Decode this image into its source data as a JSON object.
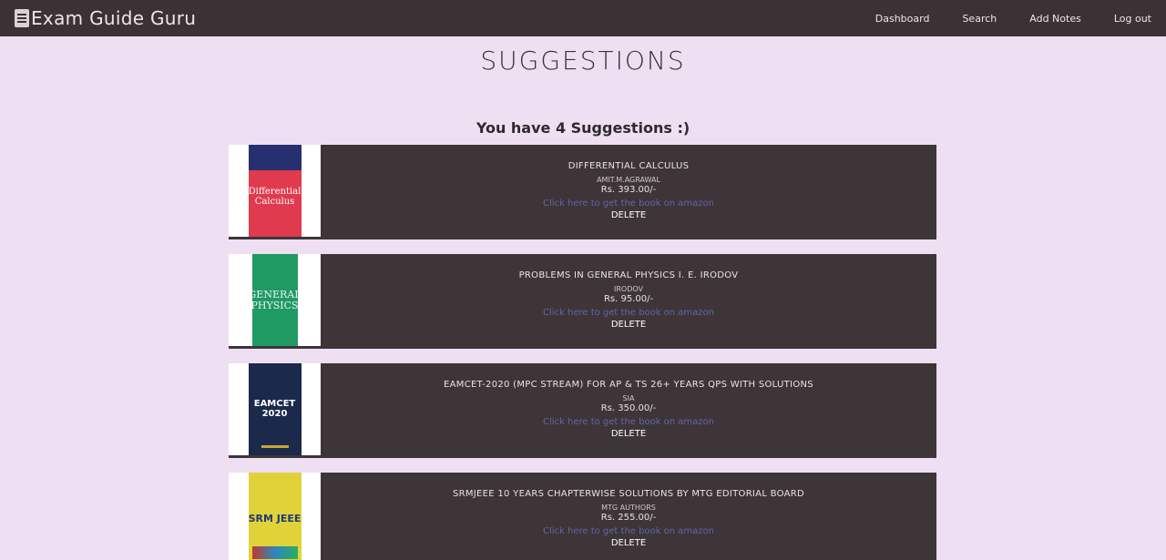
{
  "nav": {
    "brand": "Exam Guide Guru",
    "links": [
      "Dashboard",
      "Search",
      "Add Notes",
      "Log out"
    ]
  },
  "page": {
    "title": "SUGGESTIONS",
    "count_text": "You have 4 Suggestions :)"
  },
  "books": [
    {
      "title": "DIFFERENTIAL CALCULUS",
      "author": "AMIT.M.AGRAWAL",
      "price": "Rs. 393.00/-",
      "link": "Click here to get the book on amazon",
      "delete": "DELETE",
      "cover_color": "#e03a4e",
      "cover_text": "Differential Calculus"
    },
    {
      "title": "PROBLEMS IN GENERAL PHYSICS I. E. IRODOV",
      "author": "IRODOV",
      "price": "Rs. 95.00/-",
      "link": "Click here to get the book on amazon",
      "delete": "DELETE",
      "cover_color": "#1f9a62",
      "cover_text": "GENERAL PHYSICS"
    },
    {
      "title": "EAMCET-2020 (MPC STREAM) FOR AP & TS 26+ YEARS QPS WITH SOLUTIONS",
      "author": "SIA",
      "price": "Rs. 350.00/-",
      "link": "Click here to get the book on amazon",
      "delete": "DELETE",
      "cover_color": "#1b2a4a",
      "cover_text": "EAMCET 2020"
    },
    {
      "title": "SRMJEEE 10 YEARS CHAPTERWISE SOLUTIONS BY MTG EDITORIAL BOARD",
      "author": "MTG AUTHORS",
      "price": "Rs. 255.00/-",
      "link": "Click here to get the book on amazon",
      "delete": "DELETE",
      "cover_color": "#e2d23a",
      "cover_text": "SRM JEEE"
    }
  ]
}
